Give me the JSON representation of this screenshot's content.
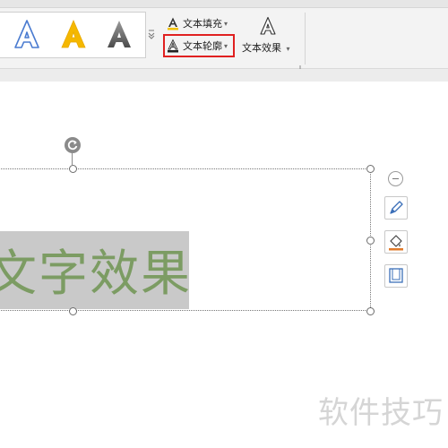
{
  "ribbon": {
    "style_gallery": [
      {
        "glyph": "A",
        "style": "outline-blue"
      },
      {
        "glyph": "A",
        "style": "fill-yellow"
      },
      {
        "glyph": "A",
        "style": "gradient-gray"
      }
    ],
    "text_fill": {
      "label": "文本填充",
      "icon": "text-fill-icon"
    },
    "text_outline": {
      "label": "文本轮廓",
      "icon": "text-outline-icon",
      "highlighted": true
    },
    "text_effect": {
      "label": "文本效果",
      "icon": "text-effect-icon"
    },
    "colors": {
      "outline_sample": "#4a7bd0",
      "fill_sample": "#f5b800",
      "highlight": "#e02020"
    }
  },
  "document": {
    "wordart_text": "文字效果",
    "wordart_color": "#7c9c63",
    "wordart_background": "#c9c9c9"
  },
  "side_toolbar": {
    "items": [
      "collapse-icon",
      "pen-icon",
      "paint-bucket-icon",
      "frame-icon"
    ]
  },
  "watermark": {
    "text": "软件技巧"
  }
}
